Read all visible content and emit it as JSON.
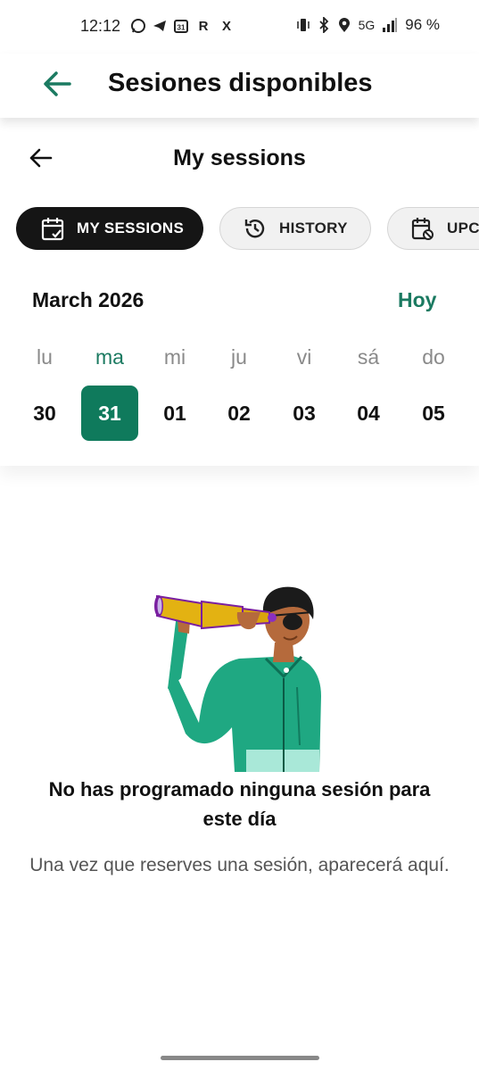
{
  "status_bar": {
    "time": "12:12",
    "app_icons": [
      "whatsapp-icon",
      "telegram-icon",
      "calendar-31-icon",
      "R",
      "X"
    ],
    "network": "5G",
    "battery": "96 %"
  },
  "app_bar": {
    "title": "Sesiones disponibles",
    "accent_color": "#1b7a61"
  },
  "sub_header": {
    "title": "My sessions"
  },
  "tabs": [
    {
      "label": "MY SESSIONS",
      "icon": "calendar-check-icon",
      "active": true
    },
    {
      "label": "HISTORY",
      "icon": "history-icon",
      "active": false
    },
    {
      "label": "UPCOMING",
      "icon": "calendar-cancel-icon",
      "active": false
    }
  ],
  "calendar": {
    "month": "March 2026",
    "today_label": "Hoy",
    "days": [
      {
        "name": "lu",
        "num": "30"
      },
      {
        "name": "ma",
        "num": "31",
        "selected": true
      },
      {
        "name": "mi",
        "num": "01"
      },
      {
        "name": "ju",
        "num": "02"
      },
      {
        "name": "vi",
        "num": "03"
      },
      {
        "name": "sá",
        "num": "04"
      },
      {
        "name": "do",
        "num": "05"
      }
    ],
    "selected_color": "#0f7a5c"
  },
  "empty_state": {
    "title": "No has programado ninguna sesión para este día",
    "subtitle": "Una vez que reserves una sesión, aparecerá aquí.",
    "illustration": "person-with-telescope"
  }
}
